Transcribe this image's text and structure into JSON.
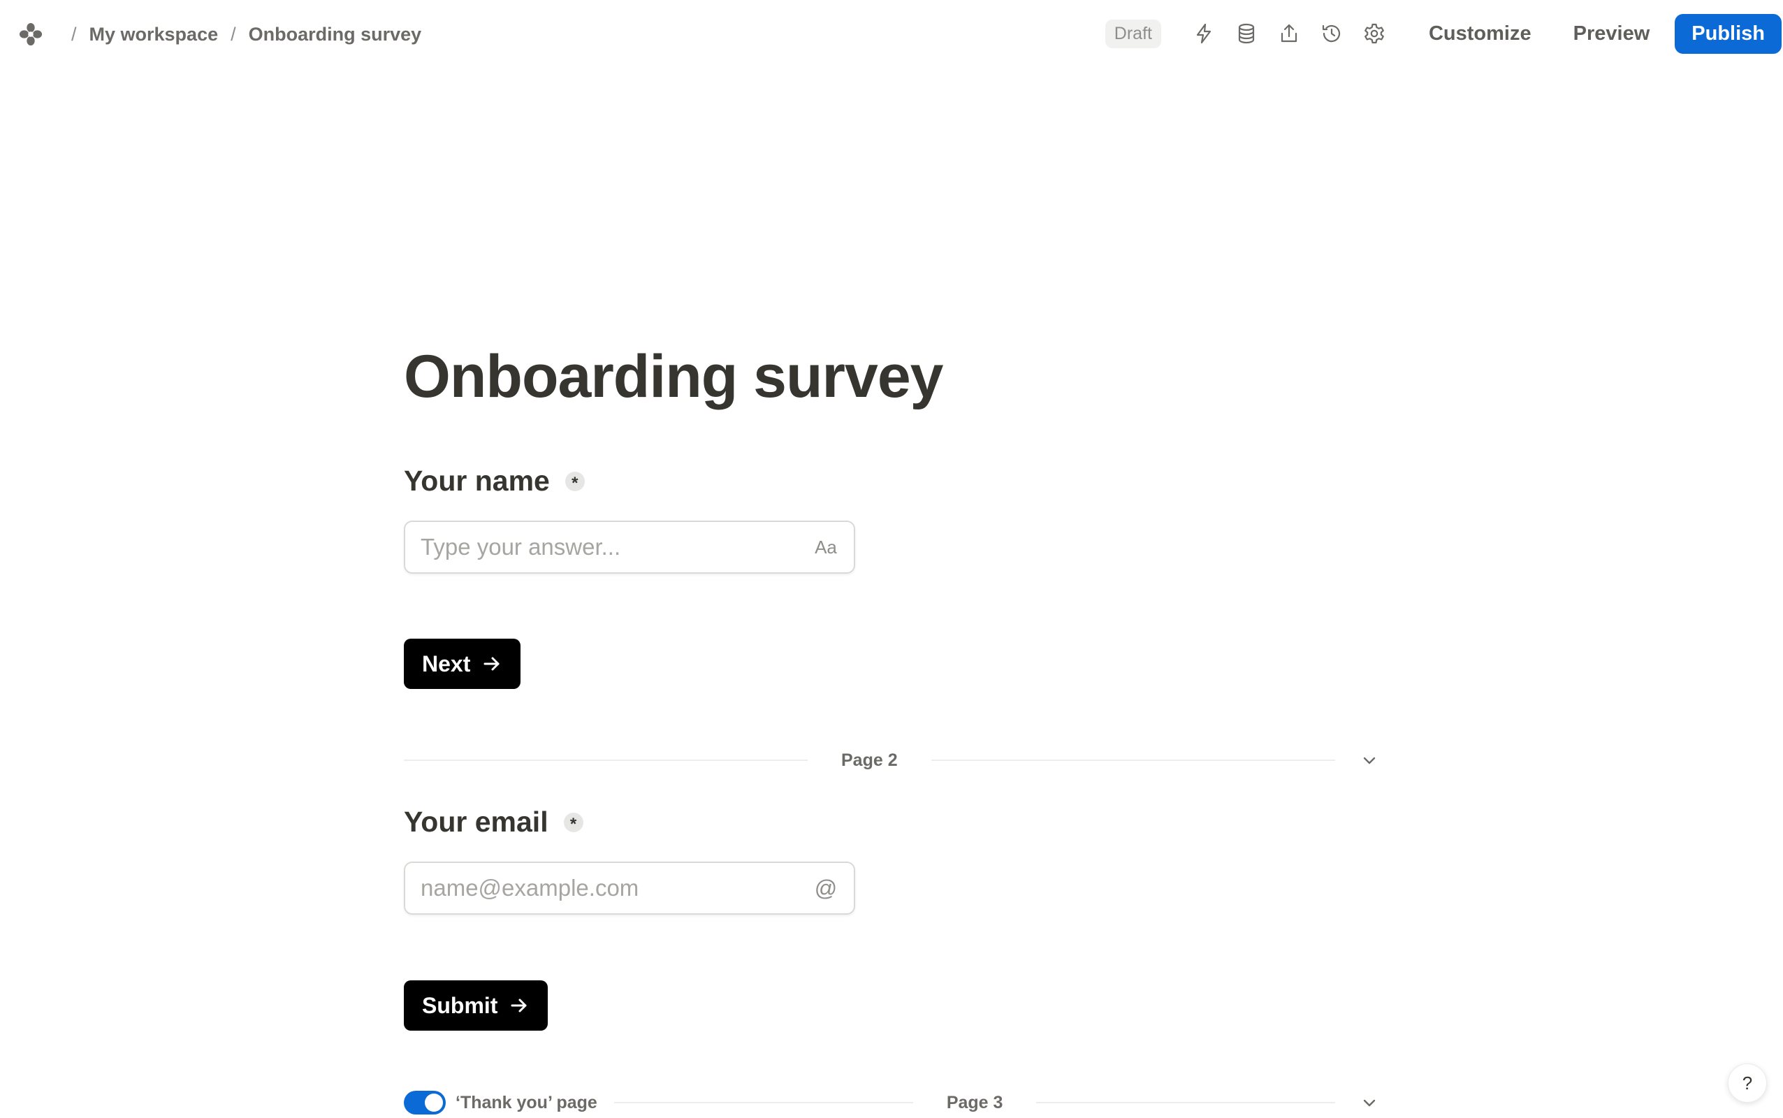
{
  "breadcrumb": {
    "logo_icon": "flower-logo-icon",
    "separator": "/",
    "workspace": "My workspace",
    "form": "Onboarding survey"
  },
  "toolbar": {
    "status": "Draft",
    "icons": [
      "lightning-icon",
      "database-icon",
      "share-icon",
      "history-icon",
      "gear-icon"
    ],
    "customize_label": "Customize",
    "preview_label": "Preview",
    "publish_label": "Publish",
    "publish_color": "#0b6ad6"
  },
  "form": {
    "title": "Onboarding survey",
    "required_marker": "*",
    "page1": {
      "question": "Your name",
      "placeholder": "Type your answer...",
      "input_icon_text": "Aa",
      "button_label": "Next"
    },
    "page2": {
      "page_label": "Page 2",
      "question": "Your email",
      "placeholder": "name@example.com",
      "input_icon_text": "@",
      "button_label": "Submit"
    },
    "page3": {
      "thank_you_label": "‘Thank you’ page",
      "thank_you_enabled": true,
      "page_label": "Page 3"
    }
  },
  "help": {
    "label": "?"
  }
}
